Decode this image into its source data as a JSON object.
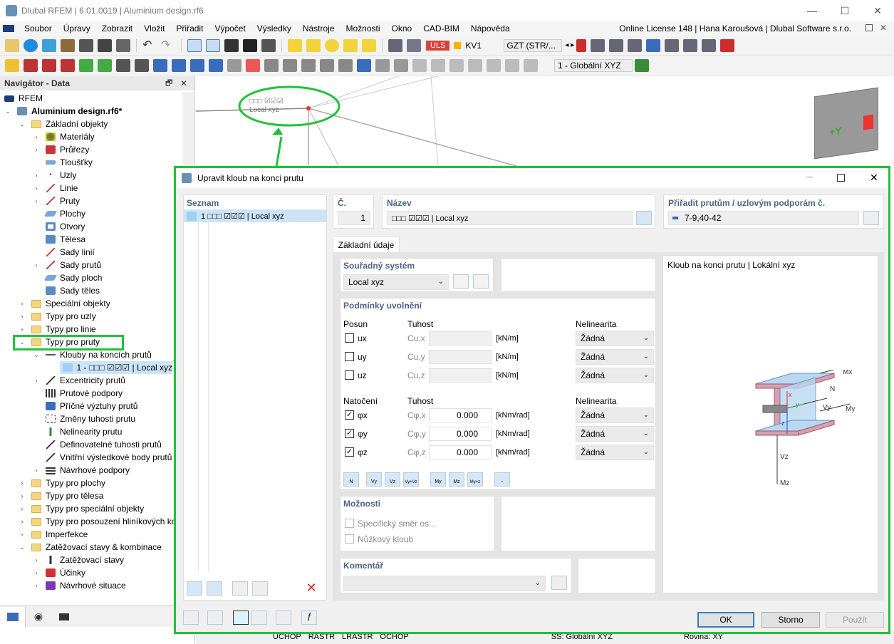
{
  "window": {
    "title": "Dlubal RFEM | 6.01.0019 | Aluminium design.rf6",
    "minimize": "—",
    "maximize": "☐",
    "close": "✕"
  },
  "menu": {
    "items": [
      "Soubor",
      "Úpravy",
      "Zobrazit",
      "Vložit",
      "Přiřadit",
      "Výpočet",
      "Výsledky",
      "Nástroje",
      "Možnosti",
      "Okno",
      "CAD-BIM",
      "Nápověda"
    ],
    "license": "Online License 148 | Hana Karoušová | Dlubal Software s.r.o."
  },
  "toolbar1": {
    "uls": "ULS",
    "kv": "KV1",
    "combo": "GZT (STR/...",
    "arrows": "◂ ▸"
  },
  "toolbar2": {
    "coord": "1 - Globální XYZ"
  },
  "navigator": {
    "title": "Navigátor - Data",
    "pin": "🗗",
    "close": "✕",
    "items": [
      {
        "label": "RFEM"
      },
      {
        "label": "Aluminium design.rf6*"
      },
      {
        "label": "Základní objekty"
      },
      {
        "label": "Materiály"
      },
      {
        "label": "Průřezy"
      },
      {
        "label": "Tloušťky"
      },
      {
        "label": "Uzly"
      },
      {
        "label": "Linie"
      },
      {
        "label": "Pruty"
      },
      {
        "label": "Plochy"
      },
      {
        "label": "Otvory"
      },
      {
        "label": "Tělesa"
      },
      {
        "label": "Sady linií"
      },
      {
        "label": "Sady prutů"
      },
      {
        "label": "Sady ploch"
      },
      {
        "label": "Sady těles"
      },
      {
        "label": "Speciální objekty"
      },
      {
        "label": "Typy pro uzly"
      },
      {
        "label": "Typy pro linie"
      },
      {
        "label": "Typy pro pruty"
      },
      {
        "label": "Klouby na koncích prutů"
      },
      {
        "label": "1 - □□□ ☑☑☑ | Local xyz"
      },
      {
        "label": "Excentricity prutů"
      },
      {
        "label": "Prutové podpory"
      },
      {
        "label": "Příčné výztuhy prutů"
      },
      {
        "label": "Změny tuhosti prutu"
      },
      {
        "label": "Nelinearity prutu"
      },
      {
        "label": "Definovatelné tuhosti prutů"
      },
      {
        "label": "Vnitřní výsledkové body prutů"
      },
      {
        "label": "Návrhové podpory"
      },
      {
        "label": "Typy pro plochy"
      },
      {
        "label": "Typy pro tělesa"
      },
      {
        "label": "Typy pro speciální objekty"
      },
      {
        "label": "Typy pro posouzení hliníkových ko"
      },
      {
        "label": "Imperfekce"
      },
      {
        "label": "Zatěžovací stavy & kombinace"
      },
      {
        "label": "Zatěžovací stavy"
      },
      {
        "label": "Účinky"
      },
      {
        "label": "Návrhové situace"
      }
    ]
  },
  "viewport": {
    "callout": "□□□ ☑☑☑\nLocal xyz",
    "cube_label": "+Y",
    "status": [
      "UCHOP",
      "RASTR",
      "LRASTR",
      "OCHOP",
      "SS: Globální XYZ",
      "Rovina: XY"
    ]
  },
  "dialog": {
    "title": "Upravit kloub na konci prutu",
    "list_header": "Seznam",
    "list_item": "1  □□□  ☑☑☑ | Local xyz",
    "no_label": "Č.",
    "no_value": "1",
    "name_label": "Název",
    "name_value": "□□□  ☑☑☑ | Local xyz",
    "assign_label": "Přiřadit prutům / uzlovým podporám č.",
    "assign_value": "7-9,40-42",
    "tab": "Základní údaje",
    "coord_label": "Souřadný systém",
    "coord_value": "Local xyz",
    "release_label": "Podmínky uvolnění",
    "posun": "Posun",
    "natoceni": "Natočení",
    "tuhost": "Tuhost",
    "nelinearita": "Nelinearita",
    "translations": [
      {
        "name": "ux",
        "c": "Cu,x",
        "unit": "[kN/m]",
        "nl": "Žádná",
        "checked": false
      },
      {
        "name": "uy",
        "c": "Cu,y",
        "unit": "[kN/m]",
        "nl": "Žádná",
        "checked": false
      },
      {
        "name": "uz",
        "c": "Cu,z",
        "unit": "[kN/m]",
        "nl": "Žádná",
        "checked": false
      }
    ],
    "rotations": [
      {
        "name": "φx",
        "c": "Cφ,x",
        "value": "0.000",
        "unit": "[kNm/rad]",
        "nl": "Žádná",
        "checked": true
      },
      {
        "name": "φy",
        "c": "Cφ,y",
        "value": "0.000",
        "unit": "[kNm/rad]",
        "nl": "Žádná",
        "checked": true
      },
      {
        "name": "φz",
        "c": "Cφ,z",
        "value": "0.000",
        "unit": "[kNm/rad]",
        "nl": "Žádná",
        "checked": true
      }
    ],
    "quick_buttons": [
      "N",
      "Vy",
      "Vz",
      "Vy+Vz",
      "My",
      "Mz",
      "My+z",
      "-"
    ],
    "options_label": "Možnosti",
    "opt1": "Specifický směr os...",
    "opt2": "Nůžkový kloub",
    "comment_label": "Komentář",
    "preview_title": "Kloub na konci prutu | Lokální xyz",
    "diagram": {
      "mx": "Mx",
      "n": "N",
      "vy": "Vy",
      "my": "My",
      "vz": "Vz",
      "mz": "Mz",
      "x": "x",
      "y": "y",
      "z": "z"
    },
    "ok": "OK",
    "cancel": "Storno",
    "apply": "Použít",
    "check": "✓"
  }
}
